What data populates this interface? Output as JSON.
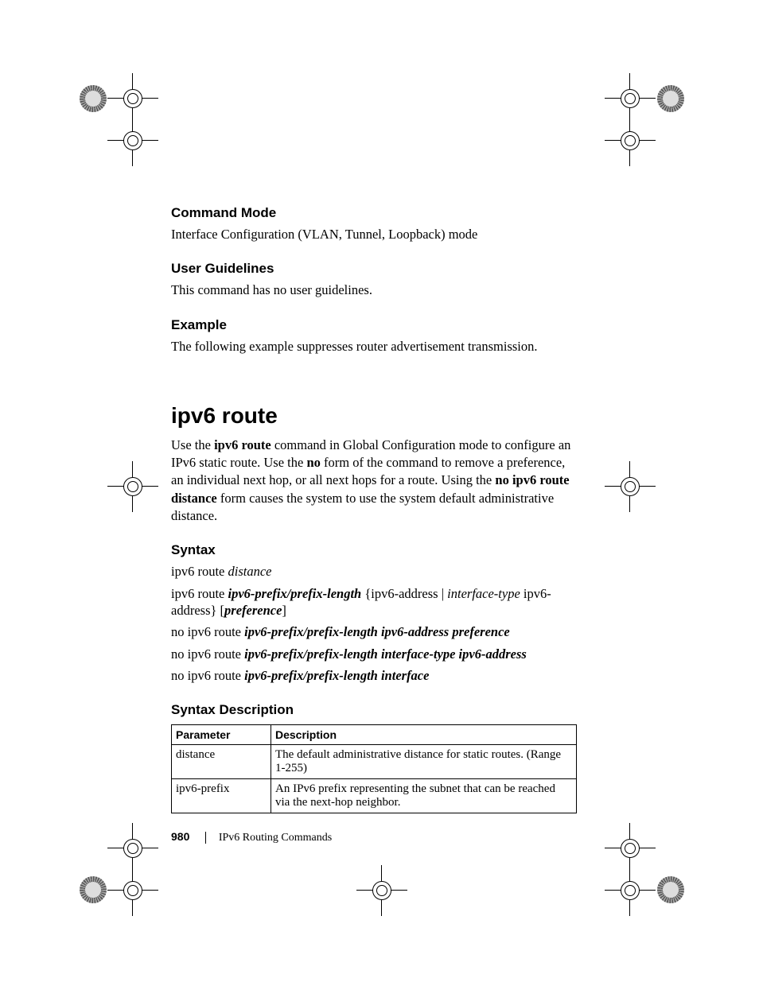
{
  "sections": {
    "command_mode": {
      "heading": "Command Mode",
      "body": "Interface Configuration (VLAN, Tunnel, Loopback) mode"
    },
    "user_guidelines": {
      "heading": "User Guidelines",
      "body": "This command has no user guidelines."
    },
    "example": {
      "heading": "Example",
      "body": "The following example suppresses router advertisement transmission."
    }
  },
  "command": {
    "title": "ipv6 route",
    "intro_pre": "Use the ",
    "intro_bold1": "ipv6 route",
    "intro_mid1": " command in Global Configuration mode to configure an IPv6 static route. Use the ",
    "intro_bold2": "no",
    "intro_mid2": " form of the command to remove a preference, an individual next hop, or all next hops for a route. Using the ",
    "intro_bold3": "no ipv6 route distance",
    "intro_post": " form causes the system to use the system default administrative distance."
  },
  "syntax": {
    "heading": "Syntax",
    "l1a": "ipv6 route ",
    "l1b": "distance",
    "l2a": "ipv6 route ",
    "l2b": "ipv6-prefix/prefix-length",
    "l2c": " {ipv6-address | ",
    "l2d": "interface-type",
    "l2e": " ipv6-address} [",
    "l2f": "preference",
    "l2g": "]",
    "l3a": "no ipv6 route ",
    "l3b": "ipv6-prefix/prefix-length ipv6-address preference",
    "l4a": "no ipv6 route ",
    "l4b": "ipv6-prefix/prefix-length interface-type ipv6-address",
    "l5a": "no ipv6 route ",
    "l5b": "ipv6-prefix/prefix-length interface"
  },
  "syntax_desc": {
    "heading": "Syntax Description",
    "th1": "Parameter",
    "th2": "Description",
    "rows": [
      {
        "p": "distance",
        "d": "The default administrative distance for static routes. (Range 1-255)"
      },
      {
        "p": "ipv6-prefix",
        "d": "An IPv6 prefix representing the subnet that can be reached via the next-hop neighbor."
      }
    ]
  },
  "footer": {
    "page": "980",
    "chapter": "IPv6 Routing Commands"
  }
}
